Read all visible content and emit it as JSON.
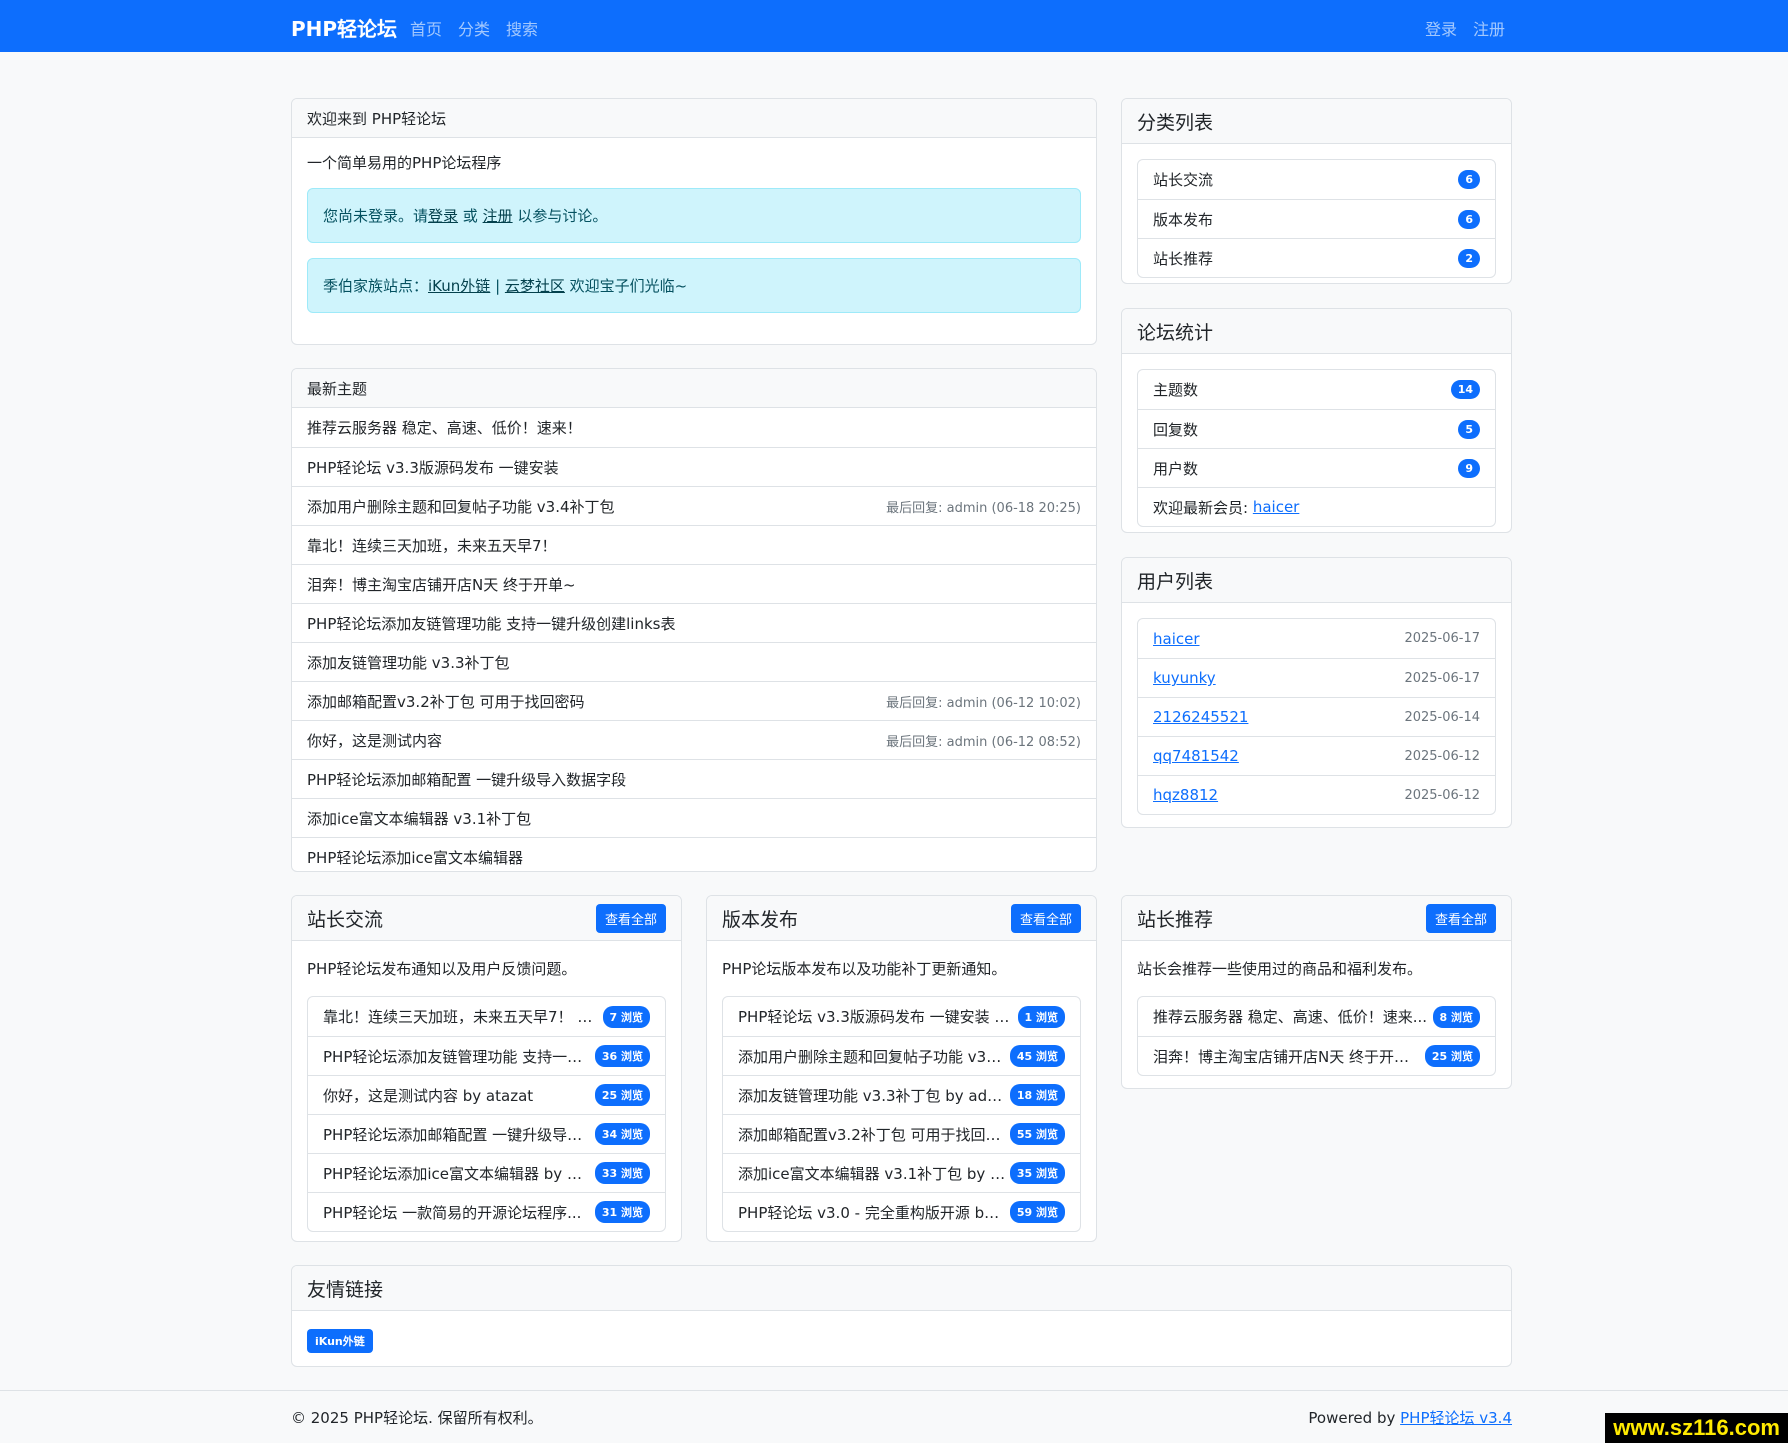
{
  "nav": {
    "brand": "PHP轻论坛",
    "home": "首页",
    "categories": "分类",
    "search": "搜索",
    "login": "登录",
    "register": "注册"
  },
  "welcome": {
    "title": "欢迎来到 PHP轻论坛",
    "desc": "一个简单易用的PHP论坛程序",
    "alert1_pre": "您尚未登录。请 ",
    "alert1_login": "登录",
    "alert1_mid": " 或 ",
    "alert1_register": "注册",
    "alert1_post": " 以参与讨论。",
    "alert2_pre": "季伯家族站点：",
    "alert2_link1": "iKun外链",
    "alert2_sep": " | ",
    "alert2_link2": "云梦社区",
    "alert2_post": " 欢迎宝子们光临~"
  },
  "latest": {
    "title": "最新主题",
    "items": [
      {
        "title": "推荐云服务器 稳定、高速、低价！速来！",
        "meta": ""
      },
      {
        "title": "PHP轻论坛 v3.3版源码发布 一键安装",
        "meta": ""
      },
      {
        "title": "添加用户删除主题和回复帖子功能 v3.4补丁包",
        "meta": "最后回复: admin (06-18 20:25)"
      },
      {
        "title": "靠北！连续三天加班，未来五天早7！",
        "meta": ""
      },
      {
        "title": "泪奔！博主淘宝店铺开店N天 终于开单~",
        "meta": ""
      },
      {
        "title": "PHP轻论坛添加友链管理功能 支持一键升级创建links表",
        "meta": ""
      },
      {
        "title": "添加友链管理功能 v3.3补丁包",
        "meta": ""
      },
      {
        "title": "添加邮箱配置v3.2补丁包 可用于找回密码",
        "meta": "最后回复: admin (06-12 10:02)"
      },
      {
        "title": "你好，这是测试内容",
        "meta": "最后回复: admin (06-12 08:52)"
      },
      {
        "title": "PHP轻论坛添加邮箱配置 一键升级导入数据字段",
        "meta": ""
      },
      {
        "title": "添加ice富文本编辑器 v3.1补丁包",
        "meta": ""
      },
      {
        "title": "PHP轻论坛添加ice富文本编辑器",
        "meta": ""
      }
    ]
  },
  "categories": {
    "title": "分类列表",
    "items": [
      {
        "name": "站长交流",
        "count": "6"
      },
      {
        "name": "版本发布",
        "count": "6"
      },
      {
        "name": "站长推荐",
        "count": "2"
      }
    ]
  },
  "stats": {
    "title": "论坛统计",
    "items": [
      {
        "name": "主题数",
        "count": "14"
      },
      {
        "name": "回复数",
        "count": "5"
      },
      {
        "name": "用户数",
        "count": "9"
      }
    ],
    "newest_label": "欢迎最新会员: ",
    "newest_user": "haicer"
  },
  "users": {
    "title": "用户列表",
    "items": [
      {
        "name": "haicer",
        "date": "2025-06-17"
      },
      {
        "name": "kuyunky",
        "date": "2025-06-17"
      },
      {
        "name": "2126245521",
        "date": "2025-06-14"
      },
      {
        "name": "qq7481542",
        "date": "2025-06-12"
      },
      {
        "name": "hqz8812",
        "date": "2025-06-12"
      }
    ]
  },
  "cat_boxes": [
    {
      "title": "站长交流",
      "button": "查看全部",
      "desc": "PHP轻论坛发布通知以及用户反馈问题。",
      "items": [
        {
          "text": "靠北！连续三天加班，未来五天早7！  b...",
          "badge": "7 浏览"
        },
        {
          "text": "PHP轻论坛添加友链管理功能 支持一键...",
          "badge": "36 浏览"
        },
        {
          "text": "你好，这是测试内容  by atazat",
          "badge": "25 浏览"
        },
        {
          "text": "PHP轻论坛添加邮箱配置 一键升级导入...",
          "badge": "34 浏览"
        },
        {
          "text": "PHP轻论坛添加ice富文本编辑器  by ad...",
          "badge": "33 浏览"
        },
        {
          "text": "PHP轻论坛 一款简易的开源论坛程序...",
          "badge": "31 浏览"
        }
      ]
    },
    {
      "title": "版本发布",
      "button": "查看全部",
      "desc": "PHP论坛版本发布以及功能补丁更新通知。",
      "items": [
        {
          "text": "PHP轻论坛 v3.3版源码发布 一键安装  b...",
          "badge": "1 浏览"
        },
        {
          "text": "添加用户删除主题和回复帖子功能 v3.4...",
          "badge": "45 浏览"
        },
        {
          "text": "添加友链管理功能 v3.3补丁包  by admin",
          "badge": "18 浏览"
        },
        {
          "text": "添加邮箱配置v3.2补丁包 可用于找回密...",
          "badge": "55 浏览"
        },
        {
          "text": "添加ice富文本编辑器 v3.1补丁包  by a...",
          "badge": "35 浏览"
        },
        {
          "text": "PHP轻论坛 v3.0 - 完全重构版开源  by ...",
          "badge": "59 浏览"
        }
      ]
    },
    {
      "title": "站长推荐",
      "button": "查看全部",
      "desc": "站长会推荐一些使用过的商品和福利发布。",
      "items": [
        {
          "text": "推荐云服务器 稳定、高速、低价！速来...",
          "badge": "8 浏览"
        },
        {
          "text": "泪奔！博主淘宝店铺开店N天 终于开单...",
          "badge": "25 浏览"
        }
      ]
    }
  ],
  "links": {
    "title": "友情链接",
    "items": [
      "iKun外链"
    ]
  },
  "footer": {
    "copyright": "© 2025 PHP轻论坛. 保留所有权利。",
    "powered": "Powered by ",
    "powered_link": "PHP轻论坛 v3.4"
  },
  "watermark": "www.sz116.com"
}
